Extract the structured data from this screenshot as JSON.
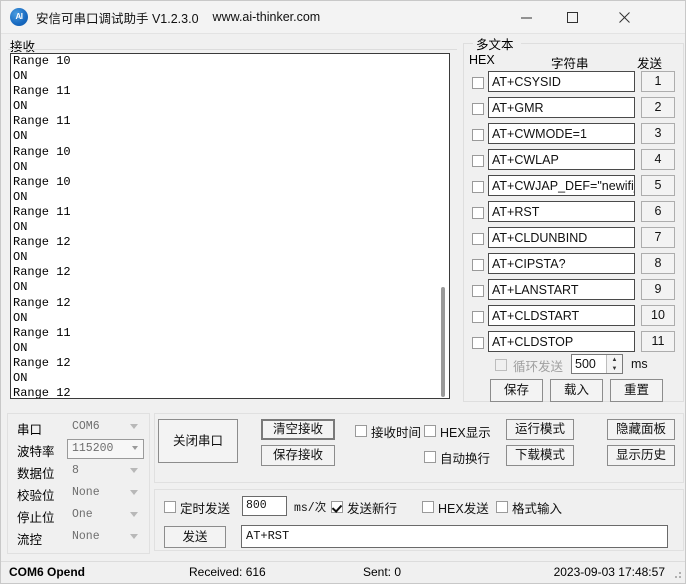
{
  "titlebar": {
    "app_title": "安信可串口调试助手 V1.2.3.0",
    "url": "www.ai-thinker.com",
    "icon_label": "AI",
    "minimize": "—",
    "maximize": "□",
    "close": "✕"
  },
  "receive": {
    "label": "接收",
    "content": "Range 10\nON\nRange 11\nON\nRange 11\nON\nRange 10\nON\nRange 10\nON\nRange 11\nON\nRange 12\nON\nRange 12\nON\nRange 12\nON\nRange 11\nON\nRange 12\nON\nRange 12\nON\nRange 12"
  },
  "multitext": {
    "legend": "多文本",
    "header_hex": "HEX",
    "header_string": "字符串",
    "header_send": "发送",
    "rows": [
      {
        "command": "AT+CSYSID",
        "send_label": "1",
        "hex_checked": false
      },
      {
        "command": "AT+GMR",
        "send_label": "2",
        "hex_checked": false
      },
      {
        "command": "AT+CWMODE=1",
        "send_label": "3",
        "hex_checked": false
      },
      {
        "command": "AT+CWLAP",
        "send_label": "4",
        "hex_checked": false
      },
      {
        "command": "AT+CWJAP_DEF=\"newifi_",
        "send_label": "5",
        "hex_checked": false
      },
      {
        "command": "AT+RST",
        "send_label": "6",
        "hex_checked": false
      },
      {
        "command": "AT+CLDUNBIND",
        "send_label": "7",
        "hex_checked": false
      },
      {
        "command": "AT+CIPSTA?",
        "send_label": "8",
        "hex_checked": false
      },
      {
        "command": "AT+LANSTART",
        "send_label": "9",
        "hex_checked": false
      },
      {
        "command": "AT+CLDSTART",
        "send_label": "10",
        "hex_checked": false
      },
      {
        "command": "AT+CLDSTOP",
        "send_label": "11",
        "hex_checked": false
      }
    ],
    "loop_send_label": "循环发送",
    "loop_send_checked": false,
    "loop_interval": "500",
    "loop_unit": "ms",
    "save_label": "保存",
    "load_label": "载入",
    "reset_label": "重置"
  },
  "config": {
    "rows": [
      {
        "label": "串口",
        "value": "COM6",
        "focused": false
      },
      {
        "label": "波特率",
        "value": "115200",
        "focused": true
      },
      {
        "label": "数据位",
        "value": "8",
        "focused": false
      },
      {
        "label": "校验位",
        "value": "None",
        "focused": false
      },
      {
        "label": "停止位",
        "value": "One",
        "focused": false
      },
      {
        "label": "流控",
        "value": "None",
        "focused": false
      }
    ]
  },
  "controls": {
    "close_port": "关闭串口",
    "clear_receive": "清空接收",
    "save_receive": "保存接收",
    "receive_time_label": "接收时间",
    "receive_time_checked": false,
    "hex_display_label": "HEX显示",
    "hex_display_checked": false,
    "auto_wrap_label": "自动换行",
    "auto_wrap_checked": false,
    "run_mode": "运行模式",
    "download_mode": "下载模式",
    "hide_panel": "隐藏面板",
    "show_history": "显示历史"
  },
  "send": {
    "timed_send_label": "定时发送",
    "timed_send_checked": false,
    "timed_interval": "800",
    "timed_unit": "ms/次",
    "send_newline_label": "发送新行",
    "send_newline_checked": true,
    "hex_send_label": "HEX发送",
    "hex_send_checked": false,
    "format_input_label": "格式输入",
    "format_input_checked": false,
    "send_button": "发送",
    "send_value": "AT+RST"
  },
  "statusbar": {
    "port_status": "COM6 Opend",
    "received": "Received: 616",
    "sent": "Sent: 0",
    "datetime": "2023-09-03 17:48:57"
  },
  "colors": {
    "accent": "#1769c0",
    "window_bg": "#f0f0f0",
    "field_bg": "#ffffff",
    "border": "#8c8c8c"
  }
}
